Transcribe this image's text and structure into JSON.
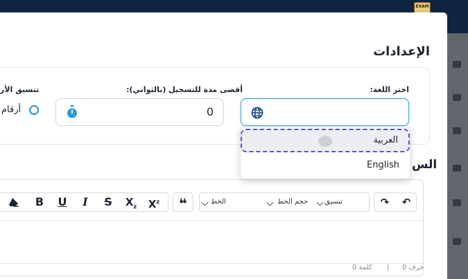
{
  "logo_text": "EXAM",
  "settings": {
    "section_title": "الإعدادات",
    "language": {
      "label": "اختر اللغة:",
      "options": [
        "العربية",
        "English"
      ],
      "highlighted": "العربية"
    },
    "max_duration": {
      "label": "أقصى مدة للتسجيل (بالثواني):",
      "value": "0"
    },
    "number_format": {
      "label": "تنسيق الأر",
      "option": "أرقام"
    }
  },
  "partial_section_title": "الس",
  "editor": {
    "toolbar": {
      "font": "الخط",
      "font_size": "حجم الخط",
      "format": "تنسيق",
      "bold": "B",
      "underline": "U",
      "italic": "I",
      "strike": "S",
      "subscript": "X",
      "superscript": "X",
      "quote": "❝",
      "undo": "↶",
      "redo": "↷"
    },
    "footer": {
      "chars": "حرف 0",
      "separator": "|",
      "words": "كلمة 0"
    }
  }
}
